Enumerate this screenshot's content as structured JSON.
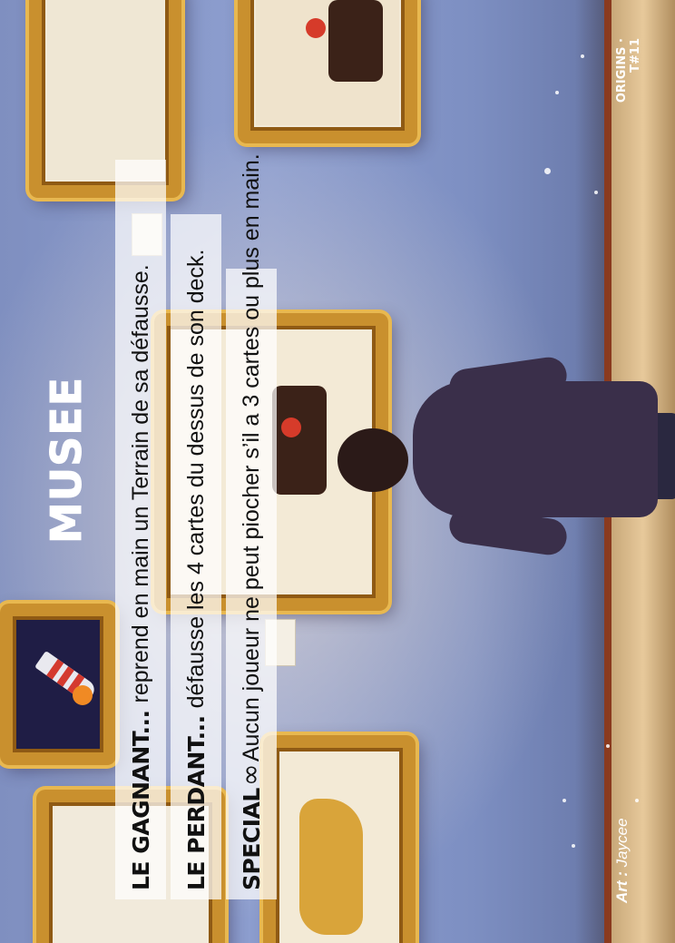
{
  "card": {
    "title": "MUSEE",
    "abilities": [
      {
        "label": "LE GAGNANT...",
        "text": "reprend en main un Terrain de sa défausse."
      },
      {
        "label": "LE PERDANT...",
        "text": "défausse les 4 cartes du dessus de son deck."
      },
      {
        "label": "SPECIAL",
        "icon": "infinity-icon",
        "symbol": "∞",
        "text": "Aucun joueur ne peut piocher s’il a 3 cartes ou plus en main."
      }
    ],
    "credit_prefix": "Art :",
    "credit_name": "Jaycee",
    "edition": "ORIGINS · T#11"
  }
}
